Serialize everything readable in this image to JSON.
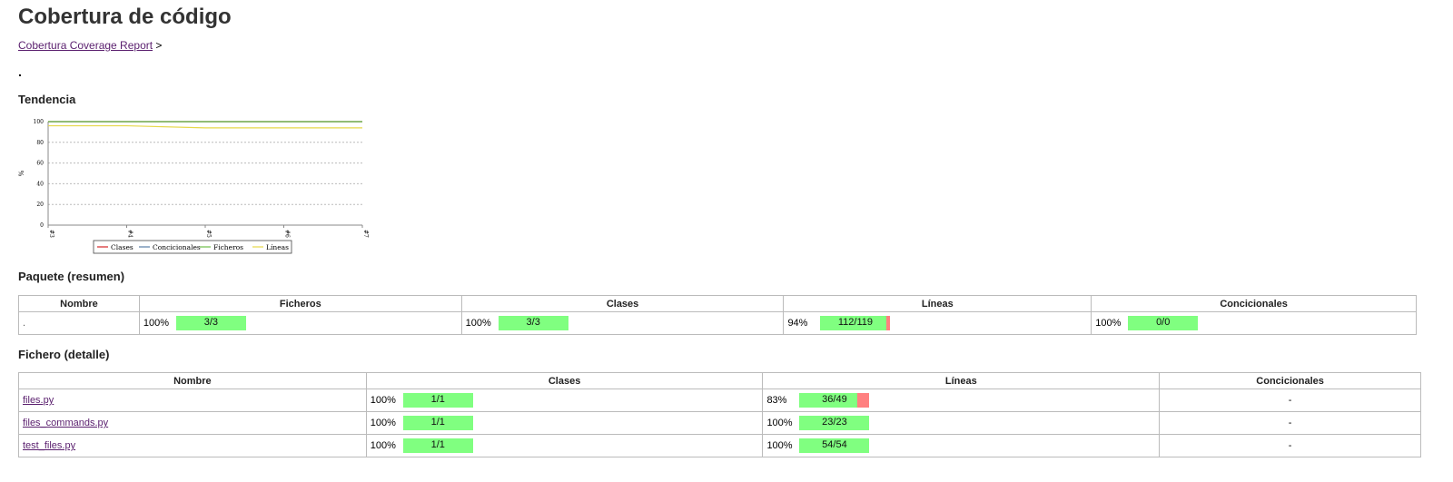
{
  "title": "Cobertura de código",
  "breadcrumb": {
    "link": "Cobertura Coverage Report",
    "sep": ">"
  },
  "package_name": ".",
  "sections": {
    "trend": "Tendencia",
    "summary": "Paquete (resumen)",
    "detail": "Fichero (detalle)"
  },
  "colors": {
    "good": "#80ff80",
    "bad": "#ff8080"
  },
  "chart_data": {
    "type": "line",
    "x": [
      "#3",
      "#4",
      "#5",
      "#6",
      "#7"
    ],
    "ylabel": "%",
    "ylim": [
      0,
      100
    ],
    "yticks": [
      "0",
      "20",
      "40",
      "60",
      "80",
      "100"
    ],
    "grid": true,
    "legend_position": "bottom",
    "series": [
      {
        "name": "Clases",
        "color": "#d62728",
        "values": [
          100,
          100,
          100,
          100,
          100
        ]
      },
      {
        "name": "Concicionales",
        "color": "#5b7fa6",
        "values": [
          100,
          100,
          100,
          100,
          100
        ]
      },
      {
        "name": "Ficheros",
        "color": "#6fbf4a",
        "values": [
          100,
          100,
          100,
          100,
          100
        ]
      },
      {
        "name": "Líneas",
        "color": "#e6d84a",
        "values": [
          96,
          96,
          94,
          94,
          94
        ]
      }
    ]
  },
  "summary_table": {
    "headers": [
      "Nombre",
      "Ficheros",
      "Clases",
      "Líneas",
      "Concicionales"
    ],
    "row": {
      "name": ".",
      "cells": [
        {
          "pct": "100%",
          "label": "3/3",
          "ratio": 1.0
        },
        {
          "pct": "100%",
          "label": "3/3",
          "ratio": 1.0
        },
        {
          "pct": "94%",
          "label": "112/119",
          "ratio": 0.94
        },
        {
          "pct": "100%",
          "label": "0/0",
          "ratio": 1.0
        }
      ]
    }
  },
  "detail_table": {
    "headers": [
      "Nombre",
      "Clases",
      "Líneas",
      "Concicionales"
    ],
    "rows": [
      {
        "name": "files.py",
        "classes": {
          "pct": "100%",
          "label": "1/1",
          "ratio": 1.0
        },
        "lines": {
          "pct": "83%",
          "label": "36/49",
          "ratio": 0.83
        },
        "cond": "-"
      },
      {
        "name": "files_commands.py",
        "classes": {
          "pct": "100%",
          "label": "1/1",
          "ratio": 1.0
        },
        "lines": {
          "pct": "100%",
          "label": "23/23",
          "ratio": 1.0
        },
        "cond": "-"
      },
      {
        "name": "test_files.py",
        "classes": {
          "pct": "100%",
          "label": "1/1",
          "ratio": 1.0
        },
        "lines": {
          "pct": "100%",
          "label": "54/54",
          "ratio": 1.0
        },
        "cond": "-"
      }
    ]
  }
}
